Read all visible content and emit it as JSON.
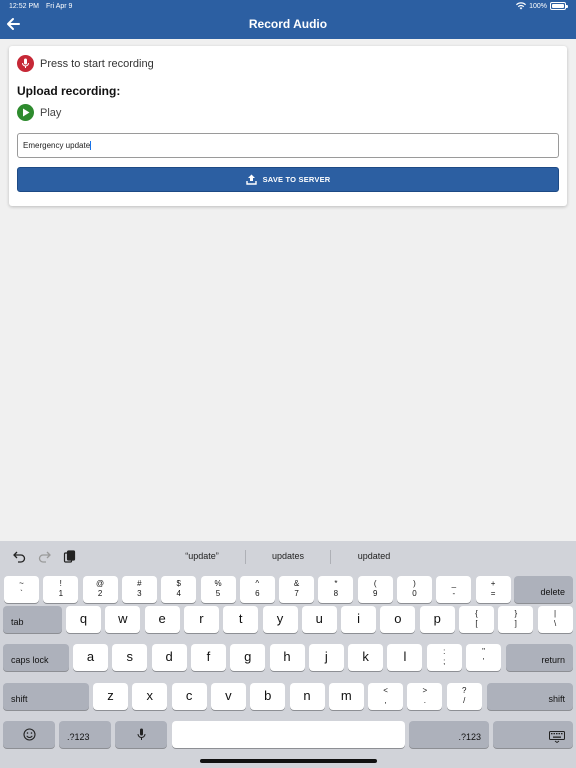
{
  "status": {
    "time": "12:52 PM",
    "date": "Fri Apr 9",
    "battery": "100%"
  },
  "header": {
    "title": "Record Audio",
    "back_icon": "arrow-left-icon"
  },
  "recorder": {
    "record_label": "Press to start recording",
    "upload_heading": "Upload recording:",
    "play_label": "Play",
    "input_value": "Emergency update",
    "save_label": "SAVE TO SERVER"
  },
  "colors": {
    "header": "#2c5fa2",
    "record": "#c62836",
    "play": "#2e8b2e",
    "keyboard": "#d1d3d9"
  },
  "keyboard": {
    "suggestions": [
      "“update”",
      "updates",
      "updated"
    ],
    "number_row": [
      {
        "top": "~",
        "bottom": "`"
      },
      {
        "top": "!",
        "bottom": "1"
      },
      {
        "top": "@",
        "bottom": "2"
      },
      {
        "top": "#",
        "bottom": "3"
      },
      {
        "top": "$",
        "bottom": "4"
      },
      {
        "top": "%",
        "bottom": "5"
      },
      {
        "top": "^",
        "bottom": "6"
      },
      {
        "top": "&",
        "bottom": "7"
      },
      {
        "top": "*",
        "bottom": "8"
      },
      {
        "top": "(",
        "bottom": "9"
      },
      {
        "top": ")",
        "bottom": "0"
      },
      {
        "top": "_",
        "bottom": "-"
      },
      {
        "top": "+",
        "bottom": "="
      }
    ],
    "delete": "delete",
    "tab": "tab",
    "row_q": [
      "q",
      "w",
      "e",
      "r",
      "t",
      "y",
      "u",
      "i",
      "o",
      "p"
    ],
    "row_q_extra": [
      {
        "top": "{",
        "bottom": "["
      },
      {
        "top": "}",
        "bottom": "]"
      },
      {
        "top": "|",
        "bottom": "\\"
      }
    ],
    "caps": "caps lock",
    "row_a": [
      "a",
      "s",
      "d",
      "f",
      "g",
      "h",
      "j",
      "k",
      "l"
    ],
    "row_a_extra": [
      {
        "top": ":",
        "bottom": ";"
      },
      {
        "top": "\"",
        "bottom": "'"
      }
    ],
    "return": "return",
    "shift": "shift",
    "row_z": [
      "z",
      "x",
      "c",
      "v",
      "b",
      "n",
      "m"
    ],
    "row_z_extra": [
      {
        "top": "<",
        "bottom": ","
      },
      {
        "top": ">",
        "bottom": "."
      },
      {
        "top": "?",
        "bottom": "/"
      }
    ],
    "numbers": ".?123"
  }
}
